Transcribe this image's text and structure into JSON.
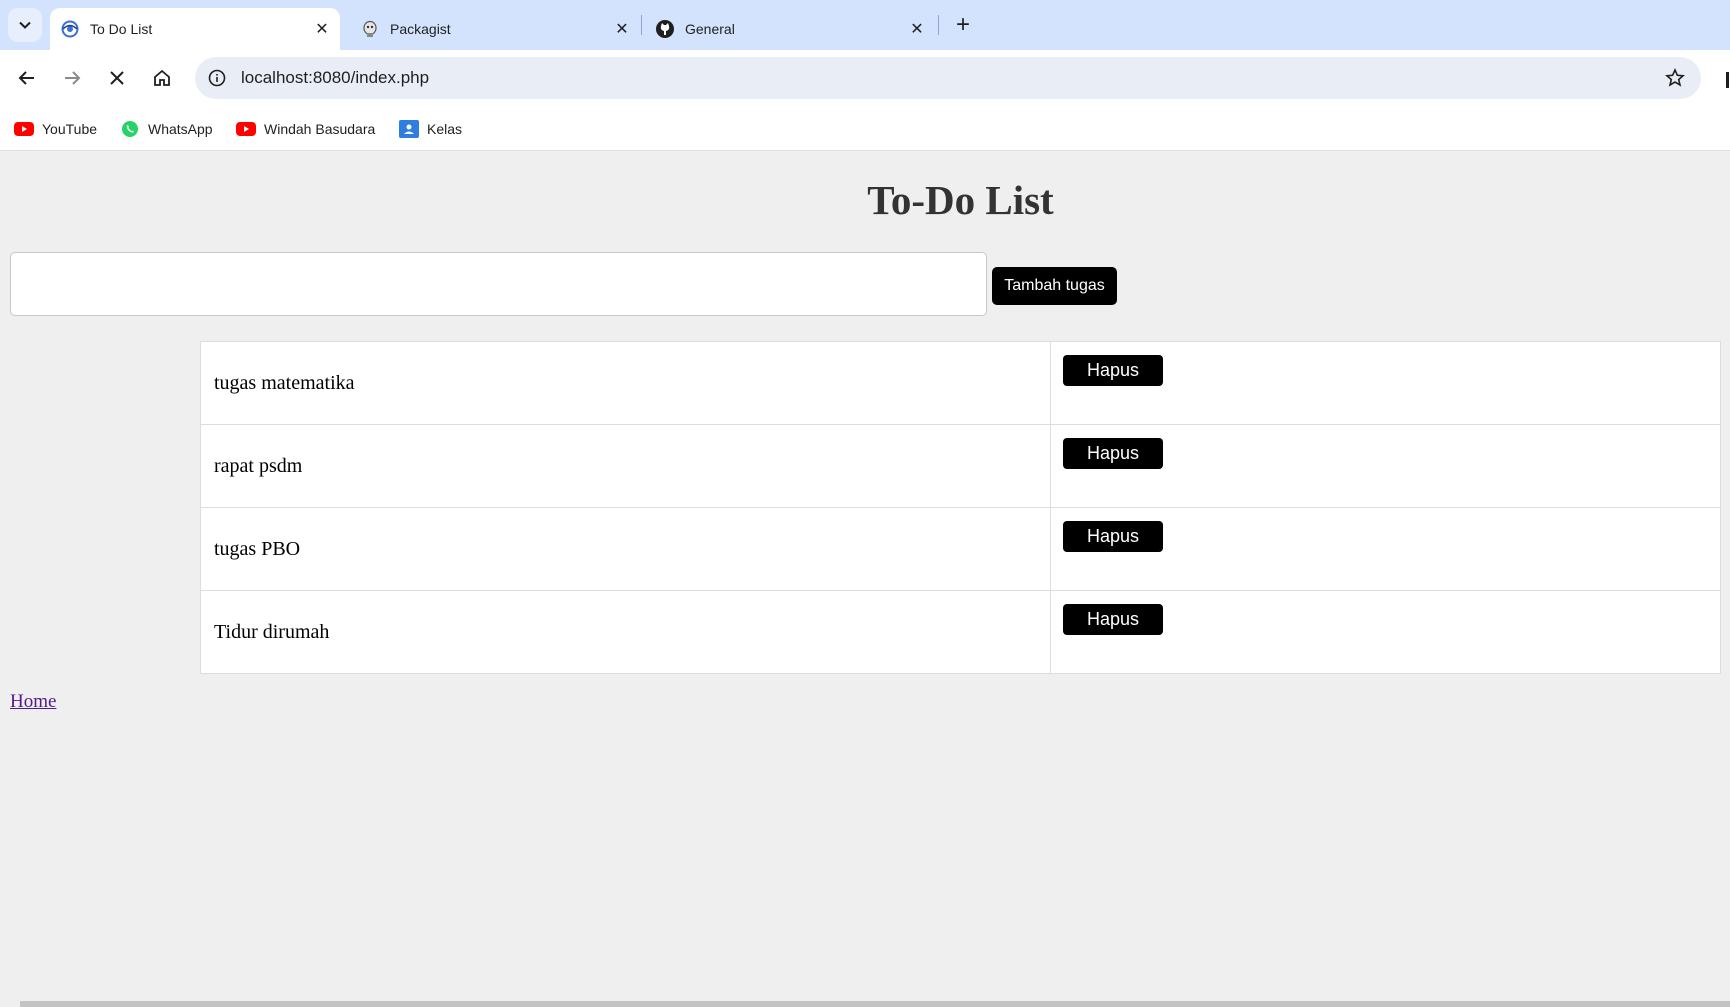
{
  "browser": {
    "tabs": [
      {
        "title": "To Do List",
        "active": true,
        "favicon": "todo-eye-icon"
      },
      {
        "title": "Packagist",
        "active": false,
        "favicon": "packagist-icon"
      },
      {
        "title": "General",
        "active": false,
        "favicon": "github-icon"
      }
    ],
    "url": "localhost:8080/index.php",
    "bookmarks": [
      {
        "label": "YouTube",
        "icon": "youtube-icon"
      },
      {
        "label": "WhatsApp",
        "icon": "whatsapp-icon"
      },
      {
        "label": "Windah Basudara",
        "icon": "youtube-icon"
      },
      {
        "label": "Kelas",
        "icon": "classroom-icon"
      }
    ]
  },
  "page": {
    "heading": "To-Do List",
    "input_value": "",
    "add_button": "Tambah tugas",
    "tasks": [
      {
        "name": "tugas matematika",
        "action": "Hapus"
      },
      {
        "name": "rapat psdm",
        "action": "Hapus"
      },
      {
        "name": "tugas PBO",
        "action": "Hapus"
      },
      {
        "name": "Tidur dirumah",
        "action": "Hapus"
      }
    ],
    "home_link": "Home"
  },
  "colors": {
    "tabstrip_bg": "#d3e3fd",
    "page_bg": "#efefef",
    "button_bg": "#000000",
    "link": "#551a8b"
  }
}
